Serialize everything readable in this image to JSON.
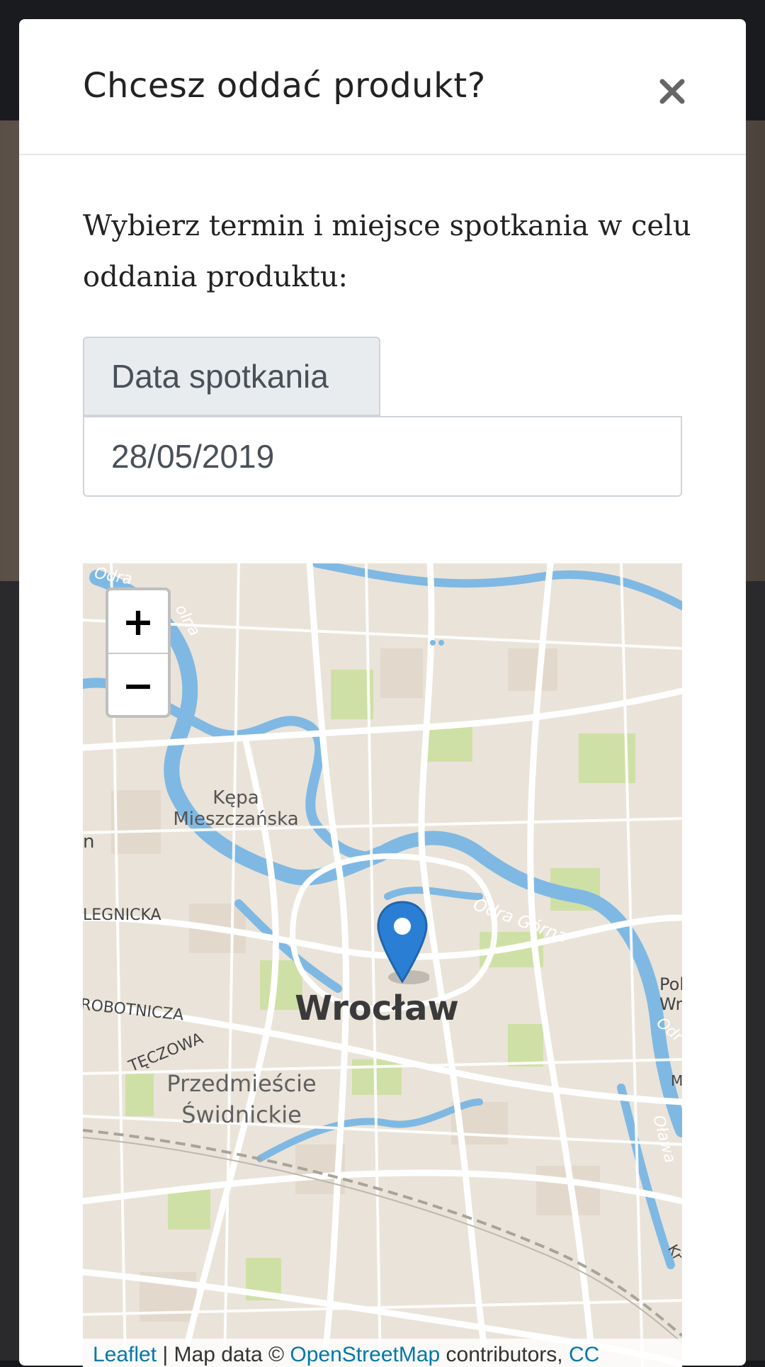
{
  "modal": {
    "title": "Chcesz oddać produkt?",
    "close_label": "×",
    "intro": "Wybierz termin i miejsce spotkania w celu oddania produktu:"
  },
  "date": {
    "addon_label": "Data spotkania",
    "value": "28/05/2019"
  },
  "map": {
    "zoom_in": "+",
    "zoom_out": "−",
    "city_label": "Wrocław",
    "district_labels": {
      "kepa": "Kępa Mieszczańska",
      "przedmiescie": "Przedmieście Świdnickie",
      "legnicka": "LEGNICKA",
      "robotnicza": "ROBOTNICZA",
      "teczowa": "TĘCZOWA",
      "odra_gorna": "Odra Górna",
      "odra_west": "Odra",
      "olawa": "Oława",
      "poli": "Poli",
      "wro": "Wro",
      "odra_right": "Odr",
      "n_left": "n",
      "m_right": "M",
      "kr": "Kr",
      "olna": "olna"
    },
    "attribution": {
      "leaflet": "Leaflet",
      "separator": " | Map data © ",
      "osm": "OpenStreetMap",
      "contributors": " contributors, ",
      "cc": "CC"
    },
    "colors": {
      "water": "#7fb9e3",
      "land": "#eae3d9",
      "park": "#cfe0a6",
      "marker": "#2a7fd4"
    }
  }
}
